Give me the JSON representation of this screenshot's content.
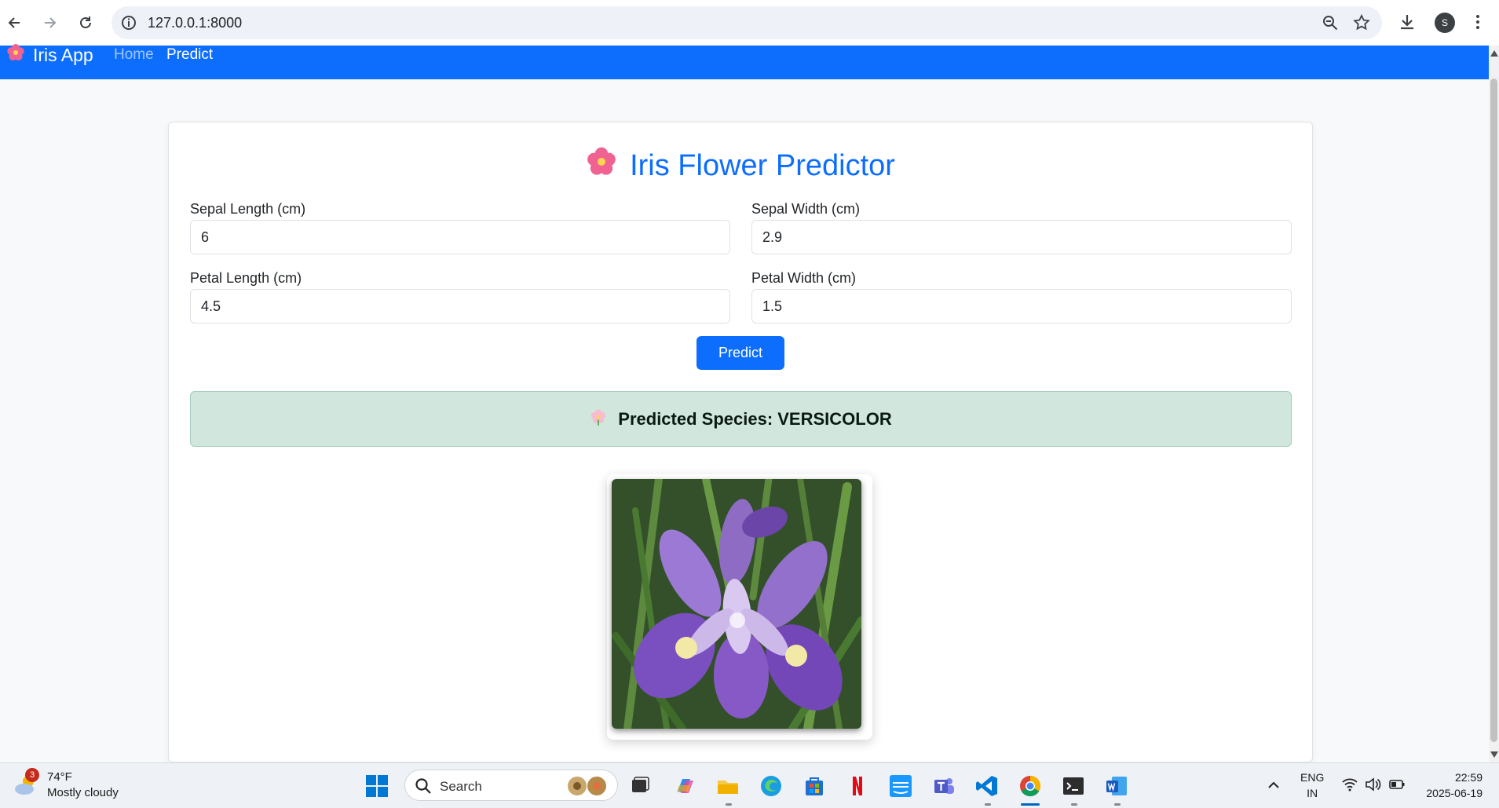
{
  "browser": {
    "url": "127.0.0.1:8000",
    "profile_initial": "S"
  },
  "navbar": {
    "brand": "Iris App",
    "links": [
      {
        "label": "Home",
        "active": false
      },
      {
        "label": "Predict",
        "active": true
      }
    ],
    "color": "#0d6efd"
  },
  "form": {
    "title": "Iris Flower Predictor",
    "fields": [
      {
        "label": "Sepal Length (cm)",
        "value": "6"
      },
      {
        "label": "Sepal Width (cm)",
        "value": "2.9"
      },
      {
        "label": "Petal Length (cm)",
        "value": "4.5"
      },
      {
        "label": "Petal Width (cm)",
        "value": "1.5"
      }
    ],
    "submit_label": "Predict"
  },
  "result": {
    "text": "Predicted Species: VERSICOLOR",
    "bg_color": "#d1e7dd"
  },
  "taskbar": {
    "weather_temp": "74°F",
    "weather_desc": "Mostly cloudy",
    "weather_badge": "3",
    "search_label": "Search",
    "lang_top": "ENG",
    "lang_bottom": "IN",
    "time": "22:59",
    "date": "2025-06-19",
    "apps": [
      "start-icon",
      "task-view-icon",
      "copilot-icon",
      "file-explorer-icon",
      "edge-icon",
      "store-icon",
      "netflix-icon",
      "prime-video-icon",
      "teams-icon",
      "vscode-icon",
      "chrome-icon",
      "terminal-icon",
      "word-icon"
    ]
  }
}
